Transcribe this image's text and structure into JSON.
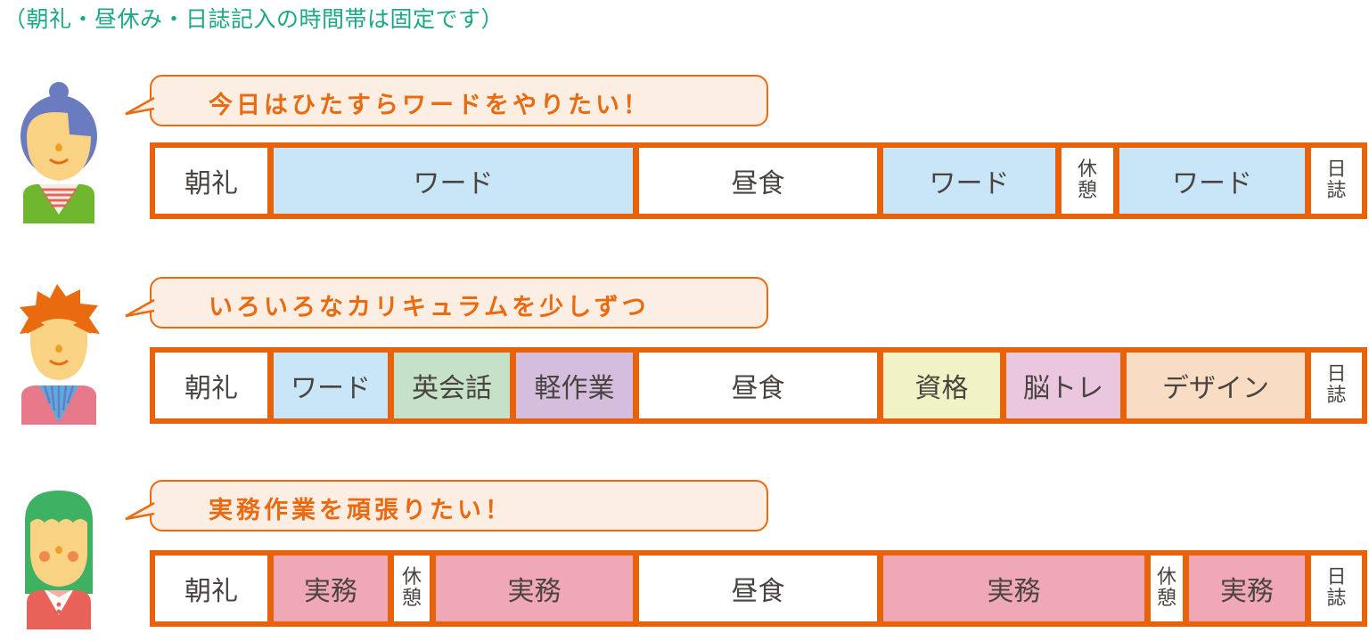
{
  "note": "（朝礼・昼休み・日誌記入の時間帯は固定です）",
  "colors": {
    "border": "#e8620a",
    "bubble_bg": "#fdeee4",
    "bubble_text": "#ea6a10",
    "note_text": "#1aa886",
    "white": "#ffffff",
    "word": "#c8e6f7",
    "english": "#c5e2c8",
    "light_work": "#d5bedd",
    "qualification": "#eff3c5",
    "brain": "#eac6df",
    "design": "#f8dcc3",
    "practice": "#f1a8b6"
  },
  "rows": [
    {
      "person": "woman-with-bun",
      "bubble": "今日はひたすらワードをやりたい！",
      "segments": [
        {
          "label": "朝礼",
          "color": "white",
          "lines": [
            "朝礼"
          ]
        },
        {
          "label": "ワード",
          "color": "word",
          "lines": [
            "ワード"
          ]
        },
        {
          "label": "昼食",
          "color": "white",
          "lines": [
            "昼食"
          ]
        },
        {
          "label": "ワード",
          "color": "word",
          "lines": [
            "ワード"
          ]
        },
        {
          "label": "休憩",
          "color": "white",
          "lines": [
            "休",
            "憩"
          ]
        },
        {
          "label": "ワード",
          "color": "word",
          "lines": [
            "ワード"
          ]
        },
        {
          "label": "日誌",
          "color": "white",
          "lines": [
            "日",
            "誌"
          ]
        }
      ]
    },
    {
      "person": "boy-with-spiky-hair",
      "bubble": "いろいろなカリキュラムを少しずつ",
      "segments": [
        {
          "label": "朝礼",
          "color": "white",
          "lines": [
            "朝礼"
          ]
        },
        {
          "label": "ワード",
          "color": "word",
          "lines": [
            "ワード"
          ]
        },
        {
          "label": "英会話",
          "color": "english",
          "lines": [
            "英会話"
          ]
        },
        {
          "label": "軽作業",
          "color": "light_work",
          "lines": [
            "軽作業"
          ]
        },
        {
          "label": "昼食",
          "color": "white",
          "lines": [
            "昼食"
          ]
        },
        {
          "label": "資格",
          "color": "qualification",
          "lines": [
            "資格"
          ]
        },
        {
          "label": "脳トレ",
          "color": "brain",
          "lines": [
            "脳トレ"
          ]
        },
        {
          "label": "デザイン",
          "color": "design",
          "lines": [
            "デザイン"
          ]
        },
        {
          "label": "日誌",
          "color": "white",
          "lines": [
            "日",
            "誌"
          ]
        }
      ]
    },
    {
      "person": "woman-with-long-green-hair",
      "bubble": "実務作業を頑張りたい！",
      "segments": [
        {
          "label": "朝礼",
          "color": "white",
          "lines": [
            "朝礼"
          ]
        },
        {
          "label": "実務",
          "color": "practice",
          "lines": [
            "実務"
          ]
        },
        {
          "label": "休憩",
          "color": "white",
          "lines": [
            "休",
            "憩"
          ]
        },
        {
          "label": "実務",
          "color": "practice",
          "lines": [
            "実務"
          ]
        },
        {
          "label": "昼食",
          "color": "white",
          "lines": [
            "昼食"
          ]
        },
        {
          "label": "実務",
          "color": "practice",
          "lines": [
            "実務"
          ]
        },
        {
          "label": "休憩",
          "color": "white",
          "lines": [
            "休",
            "憩"
          ]
        },
        {
          "label": "実務",
          "color": "practice",
          "lines": [
            "実務"
          ]
        },
        {
          "label": "日誌",
          "color": "white",
          "lines": [
            "日",
            "誌"
          ]
        }
      ]
    }
  ]
}
